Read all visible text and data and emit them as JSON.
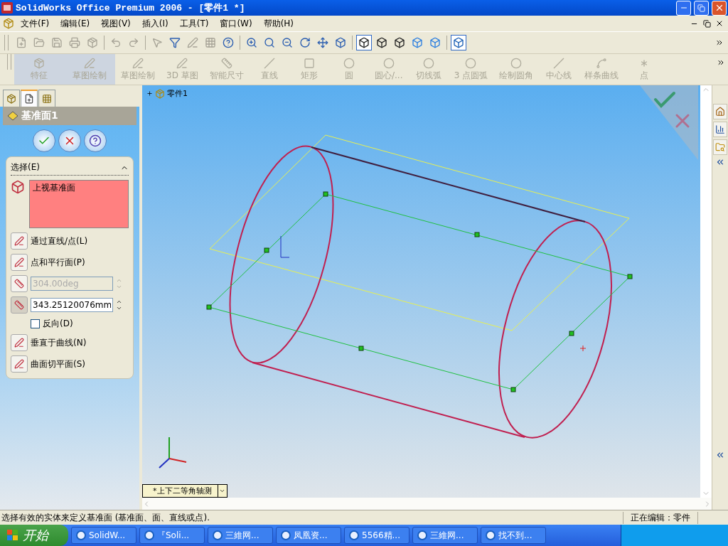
{
  "window": {
    "title": "SolidWorks Office Premium 2006 - [零件1 *]"
  },
  "menu": [
    {
      "label": "文件(F)"
    },
    {
      "label": "编辑(E)"
    },
    {
      "label": "视图(V)"
    },
    {
      "label": "插入(I)"
    },
    {
      "label": "工具(T)"
    },
    {
      "label": "窗口(W)"
    },
    {
      "label": "帮助(H)"
    }
  ],
  "command_manager": [
    {
      "kind": "tab",
      "label": "特征"
    },
    {
      "kind": "tab",
      "label": "草图绘制"
    },
    {
      "kind": "tool",
      "label": "草图绘制"
    },
    {
      "kind": "tool",
      "label": "3D 草图"
    },
    {
      "kind": "tool",
      "label": "智能尺寸"
    },
    {
      "kind": "tool",
      "label": "直线"
    },
    {
      "kind": "tool",
      "label": "矩形"
    },
    {
      "kind": "tool",
      "label": "圆"
    },
    {
      "kind": "tool",
      "label": "圆心/..."
    },
    {
      "kind": "tool",
      "label": "切线弧"
    },
    {
      "kind": "tool",
      "label": "3 点圆弧"
    },
    {
      "kind": "tool",
      "label": "绘制圆角"
    },
    {
      "kind": "tool",
      "label": "中心线"
    },
    {
      "kind": "tool",
      "label": "样条曲线"
    },
    {
      "kind": "tool",
      "label": "点"
    }
  ],
  "property_manager": {
    "tabs": [
      {
        "selected": false
      },
      {
        "selected": true
      },
      {
        "selected": false
      }
    ],
    "title": "基准面1",
    "section": "选择(E)",
    "selection": "上视基准面",
    "options": [
      {
        "kind": "button",
        "label": "通过直线/点(L)"
      },
      {
        "kind": "button",
        "label": "点和平行面(P)"
      },
      {
        "kind": "field",
        "value": "304.00deg",
        "disabled": true,
        "pressed": false
      },
      {
        "kind": "field",
        "value": "343.25120076mm",
        "disabled": false,
        "pressed": true
      },
      {
        "kind": "checkbox",
        "label": "反向(D)",
        "checked": false
      },
      {
        "kind": "button",
        "label": "垂直于曲线(N)"
      },
      {
        "kind": "button",
        "label": "曲面切平面(S)"
      }
    ]
  },
  "viewport": {
    "tree_root": "零件1",
    "view_orientation": "*上下二等角轴测"
  },
  "status_bar": {
    "message": "选择有效的实体来定义基准面 (基准面、面、直线或点).",
    "mode": "正在编辑：零件"
  },
  "taskbar": {
    "start": "开始",
    "tasks": [
      {
        "label": "SolidW..."
      },
      {
        "label": "『Soli..."
      },
      {
        "label": "三維网..."
      },
      {
        "label": "凤凰资..."
      },
      {
        "label": "5566精..."
      },
      {
        "label": "三維网..."
      },
      {
        "label": "找不到..."
      }
    ]
  }
}
